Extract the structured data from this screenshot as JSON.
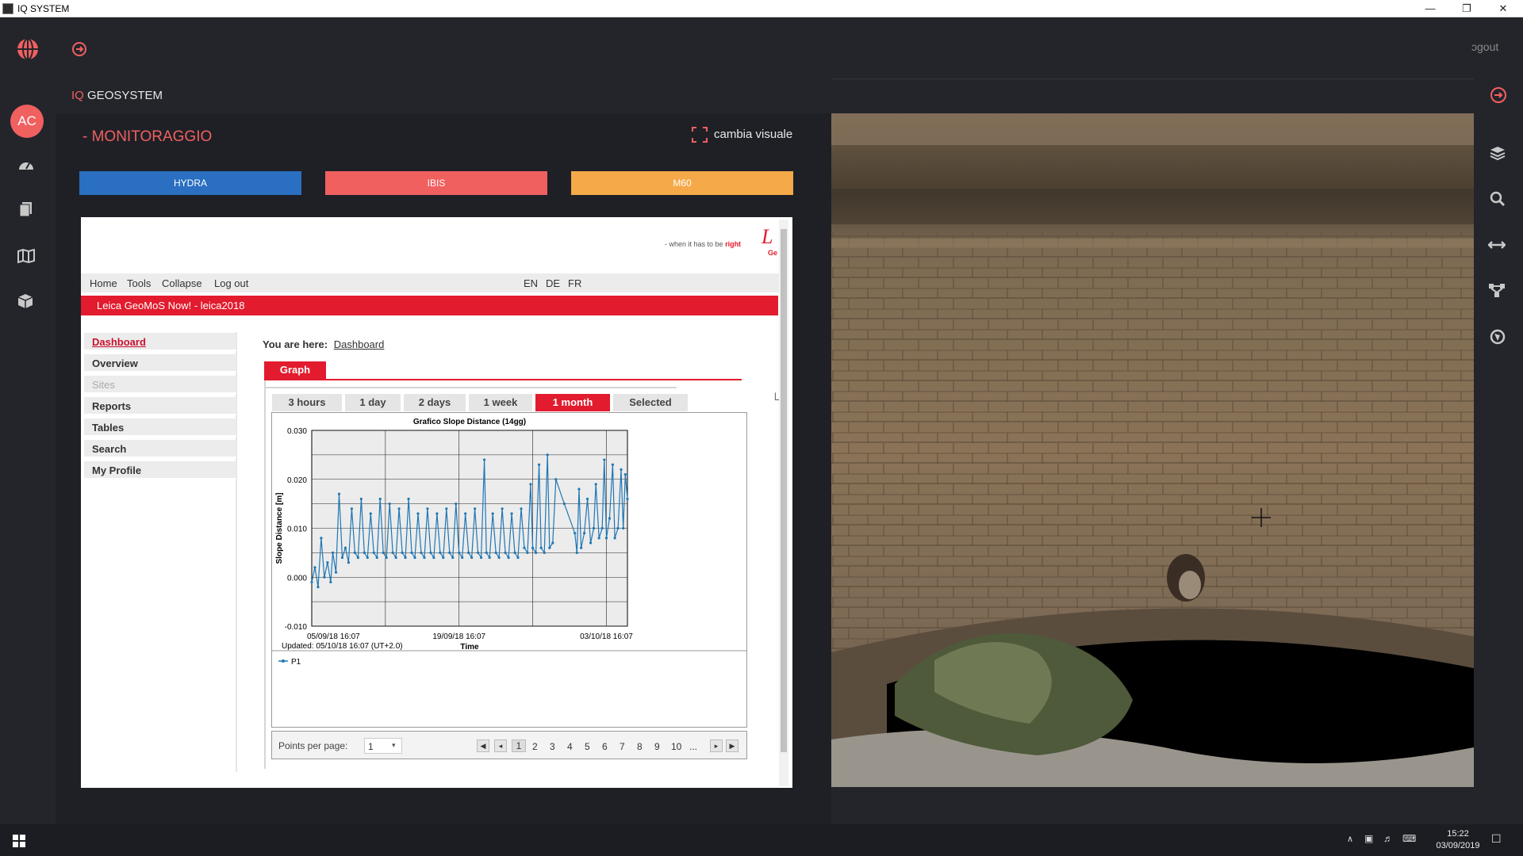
{
  "window": {
    "title": "IQ SYSTEM"
  },
  "header": {
    "brand_prefix": "IQ",
    "brand_name": "GEOSYSTEM",
    "logout_label": "ɔgout",
    "avatar_initials": "AC"
  },
  "panel": {
    "title": "- MONITORAGGIO",
    "change_view_label": "cambia visuale",
    "systems": [
      {
        "label": "HYDRA",
        "color": "#2a6fc1"
      },
      {
        "label": "IBIS",
        "color": "#f0605f"
      },
      {
        "label": "M60",
        "color": "#f5a948"
      }
    ]
  },
  "geomos": {
    "tagline_prefix": "- when it has to be",
    "tagline_emph": "right",
    "logo_partial": "Ge",
    "nav": [
      "Home",
      "Tools",
      "Collapse",
      "Log out"
    ],
    "languages": [
      "EN",
      "DE",
      "FR"
    ],
    "banner": "Leica GeoMoS Now! - leica2018",
    "menu": [
      "Dashboard",
      "Overview",
      "Sites",
      "Reports",
      "Tables",
      "Search",
      "My Profile"
    ],
    "breadcrumb_label": "You are here:",
    "breadcrumb_link": "Dashboard",
    "graph_tab": "Graph",
    "ranges": [
      "3 hours",
      "1 day",
      "2 days",
      "1 week",
      "1 month",
      "Selected"
    ],
    "active_range": "1 month",
    "updated": "Updated: 05/10/18 16:07 (UT+2.0)",
    "pager": {
      "label": "Points per page:",
      "value": "1",
      "pages": [
        "1",
        "2",
        "3",
        "4",
        "5",
        "6",
        "7",
        "8",
        "9",
        "10",
        "..."
      ]
    }
  },
  "chart_data": {
    "type": "line",
    "title": "Grafico Slope Distance (14gg)",
    "xlabel": "Time",
    "ylabel": "Slope Distance [m]",
    "ylim": [
      -0.01,
      0.03
    ],
    "yticks": [
      "0.030",
      "0.020",
      "0.010",
      "0.000",
      "-0.010"
    ],
    "xticks": [
      "05/09/18 16:07",
      "19/09/18 16:07",
      "03/10/18 16:07"
    ],
    "xlim_days": [
      0,
      30
    ],
    "legend": "P1",
    "series": [
      {
        "name": "P1",
        "color": "#1f77b4",
        "points": [
          [
            0.0,
            -0.001
          ],
          [
            0.3,
            0.002
          ],
          [
            0.6,
            -0.002
          ],
          [
            0.9,
            0.008
          ],
          [
            1.2,
            0.0
          ],
          [
            1.5,
            0.003
          ],
          [
            1.8,
            -0.001
          ],
          [
            2.0,
            0.005
          ],
          [
            2.3,
            0.001
          ],
          [
            2.6,
            0.017
          ],
          [
            2.9,
            0.004
          ],
          [
            3.2,
            0.006
          ],
          [
            3.5,
            0.003
          ],
          [
            3.8,
            0.014
          ],
          [
            4.1,
            0.005
          ],
          [
            4.4,
            0.004
          ],
          [
            4.7,
            0.016
          ],
          [
            5.0,
            0.005
          ],
          [
            5.3,
            0.004
          ],
          [
            5.6,
            0.013
          ],
          [
            5.9,
            0.005
          ],
          [
            6.2,
            0.004
          ],
          [
            6.5,
            0.016
          ],
          [
            6.8,
            0.005
          ],
          [
            7.1,
            0.004
          ],
          [
            7.4,
            0.015
          ],
          [
            7.7,
            0.005
          ],
          [
            8.0,
            0.004
          ],
          [
            8.3,
            0.014
          ],
          [
            8.6,
            0.005
          ],
          [
            8.9,
            0.004
          ],
          [
            9.2,
            0.016
          ],
          [
            9.5,
            0.005
          ],
          [
            9.8,
            0.004
          ],
          [
            10.1,
            0.013
          ],
          [
            10.4,
            0.005
          ],
          [
            10.7,
            0.004
          ],
          [
            11.0,
            0.014
          ],
          [
            11.3,
            0.005
          ],
          [
            11.6,
            0.004
          ],
          [
            11.9,
            0.013
          ],
          [
            12.2,
            0.005
          ],
          [
            12.5,
            0.004
          ],
          [
            12.8,
            0.014
          ],
          [
            13.1,
            0.005
          ],
          [
            13.4,
            0.004
          ],
          [
            13.7,
            0.015
          ],
          [
            14.0,
            0.005
          ],
          [
            14.3,
            0.004
          ],
          [
            14.6,
            0.013
          ],
          [
            14.9,
            0.005
          ],
          [
            15.2,
            0.004
          ],
          [
            15.5,
            0.014
          ],
          [
            15.8,
            0.005
          ],
          [
            16.1,
            0.004
          ],
          [
            16.4,
            0.024
          ],
          [
            16.6,
            0.005
          ],
          [
            16.9,
            0.004
          ],
          [
            17.2,
            0.013
          ],
          [
            17.5,
            0.005
          ],
          [
            17.8,
            0.004
          ],
          [
            18.1,
            0.014
          ],
          [
            18.4,
            0.005
          ],
          [
            18.7,
            0.004
          ],
          [
            19.0,
            0.013
          ],
          [
            19.3,
            0.005
          ],
          [
            19.6,
            0.004
          ],
          [
            19.9,
            0.014
          ],
          [
            20.2,
            0.006
          ],
          [
            20.5,
            0.005
          ],
          [
            20.8,
            0.019
          ],
          [
            21.0,
            0.006
          ],
          [
            21.3,
            0.005
          ],
          [
            21.6,
            0.023
          ],
          [
            21.8,
            0.006
          ],
          [
            22.1,
            0.005
          ],
          [
            22.4,
            0.025
          ],
          [
            22.6,
            0.006
          ],
          [
            22.9,
            0.007
          ],
          [
            23.2,
            0.02
          ],
          [
            24.0,
            0.015
          ],
          [
            25.0,
            0.009
          ],
          [
            25.2,
            0.005
          ],
          [
            25.4,
            0.018
          ],
          [
            25.6,
            0.006
          ],
          [
            25.9,
            0.009
          ],
          [
            26.2,
            0.016
          ],
          [
            26.5,
            0.007
          ],
          [
            26.8,
            0.01
          ],
          [
            27.0,
            0.019
          ],
          [
            27.3,
            0.008
          ],
          [
            27.6,
            0.01
          ],
          [
            27.8,
            0.024
          ],
          [
            28.0,
            0.008
          ],
          [
            28.3,
            0.012
          ],
          [
            28.6,
            0.023
          ],
          [
            28.8,
            0.008
          ],
          [
            29.1,
            0.01
          ],
          [
            29.4,
            0.022
          ],
          [
            29.6,
            0.01
          ],
          [
            29.8,
            0.021
          ],
          [
            30.0,
            0.016
          ]
        ]
      }
    ]
  },
  "taskbar": {
    "time": "15:22",
    "date": "03/09/2019"
  }
}
